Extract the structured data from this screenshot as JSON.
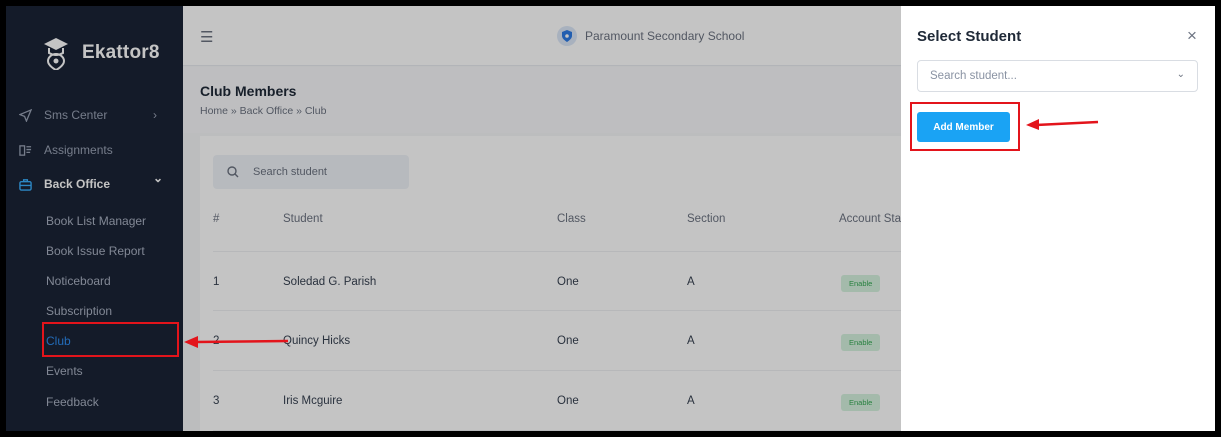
{
  "app": {
    "name": "Ekattor8",
    "school": "Paramount Secondary School"
  },
  "sidebar": {
    "items": [
      {
        "label": "Sms Center",
        "chevron": "›"
      },
      {
        "label": "Assignments"
      },
      {
        "label": "Back Office",
        "chevron": "⌄"
      }
    ],
    "sub_items": [
      "Book List Manager",
      "Book Issue Report",
      "Noticeboard",
      "Subscription",
      "Club",
      "Events",
      "Feedback"
    ]
  },
  "page": {
    "title": "Club Members",
    "breadcrumb": "Home » Back Office » Club",
    "search_placeholder": "Search student"
  },
  "table": {
    "headers": [
      "#",
      "Student",
      "Class",
      "Section",
      "Account Stat"
    ],
    "rows": [
      {
        "num": "1",
        "student": "Soledad G. Parish",
        "class": "One",
        "section": "A",
        "status": "Enable"
      },
      {
        "num": "2",
        "student": "Quincy Hicks",
        "class": "One",
        "section": "A",
        "status": "Enable"
      },
      {
        "num": "3",
        "student": "Iris Mcguire",
        "class": "One",
        "section": "A",
        "status": "Enable"
      }
    ]
  },
  "drawer": {
    "title": "Select Student",
    "close": "×",
    "select_placeholder": "Search student...",
    "add_button": "Add Member"
  },
  "colors": {
    "sidebar_bg": "#1b2436",
    "accent": "#1aa3f4",
    "annotation": "#e3141b",
    "badge_bg": "#d6f3df",
    "badge_text": "#34a853"
  }
}
